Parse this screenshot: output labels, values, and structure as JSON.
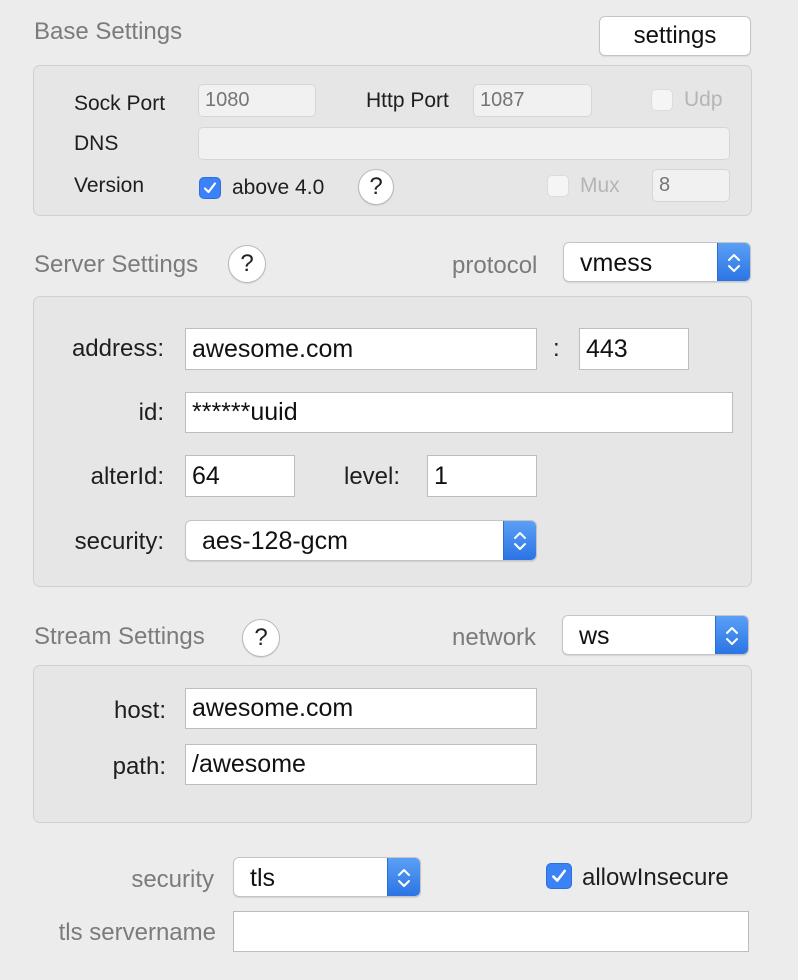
{
  "base": {
    "title": "Base Settings",
    "settings_button": "settings",
    "sock_port_label": "Sock Port",
    "sock_port_placeholder": "1080",
    "http_port_label": "Http Port",
    "http_port_placeholder": "1087",
    "udp_label": "Udp",
    "udp_checked": false,
    "dns_label": "DNS",
    "dns_value": "",
    "version_label": "Version",
    "above_label": "above 4.0",
    "above_checked": true,
    "mux_label": "Mux",
    "mux_checked": false,
    "mux_placeholder": "8",
    "help": "?"
  },
  "server": {
    "title": "Server Settings",
    "help": "?",
    "protocol_label": "protocol",
    "protocol_value": "vmess",
    "address_label": "address:",
    "address_value": "awesome.com",
    "colon": ":",
    "port_value": "443",
    "id_label": "id:",
    "id_value": "******uuid",
    "alterid_label": "alterId:",
    "alterid_value": "64",
    "level_label": "level:",
    "level_value": "1",
    "security_label": "security:",
    "security_value": "aes-128-gcm"
  },
  "stream": {
    "title": "Stream Settings",
    "help": "?",
    "network_label": "network",
    "network_value": "ws",
    "host_label": "host:",
    "host_value": "awesome.com",
    "path_label": "path:",
    "path_value": "/awesome"
  },
  "tls": {
    "security_label": "security",
    "security_value": "tls",
    "allow_insecure_label": "allowInsecure",
    "allow_insecure_checked": true,
    "servername_label": "tls servername",
    "servername_value": ""
  },
  "colors": {
    "accent": "#3b82f6",
    "window_bg": "#ececec",
    "group_bg": "#e6e6e6",
    "group_title": "#7b7b7b"
  }
}
